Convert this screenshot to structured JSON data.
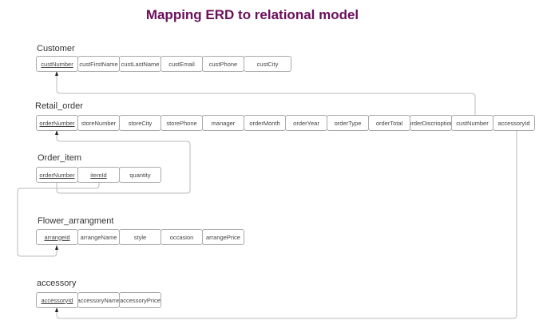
{
  "title": "Mapping ERD to relational model",
  "tables": [
    {
      "name": "Customer",
      "columns": [
        {
          "label": "custNumber",
          "pk": true
        },
        {
          "label": "custFirstName"
        },
        {
          "label": "custLastName"
        },
        {
          "label": "custEmail"
        },
        {
          "label": "custPhone"
        },
        {
          "label": "custCity"
        }
      ]
    },
    {
      "name": "Retail_order",
      "columns": [
        {
          "label": "orderNumber",
          "pk": true
        },
        {
          "label": "storeNumber"
        },
        {
          "label": "storeCity"
        },
        {
          "label": "storePhone"
        },
        {
          "label": "manager"
        },
        {
          "label": "orderMonth"
        },
        {
          "label": "orderYear"
        },
        {
          "label": "orderType"
        },
        {
          "label": "orderTotal"
        },
        {
          "label": "orderDiscrioption"
        },
        {
          "label": "custNumber"
        },
        {
          "label": "accessoryId"
        }
      ]
    },
    {
      "name": "Order_item",
      "columns": [
        {
          "label": "orderNumber",
          "pk": true
        },
        {
          "label": "itemId",
          "pk": true
        },
        {
          "label": "quantity"
        }
      ]
    },
    {
      "name": "Flower_arrangment",
      "columns": [
        {
          "label": "arrangeId",
          "pk": true
        },
        {
          "label": "arrangeName"
        },
        {
          "label": "style"
        },
        {
          "label": "occasion"
        },
        {
          "label": "arrangePrice"
        }
      ]
    },
    {
      "name": "accessory",
      "columns": [
        {
          "label": "accessoryId",
          "pk": true
        },
        {
          "label": "accessoryName"
        },
        {
          "label": "accessoryPrice"
        }
      ]
    }
  ]
}
